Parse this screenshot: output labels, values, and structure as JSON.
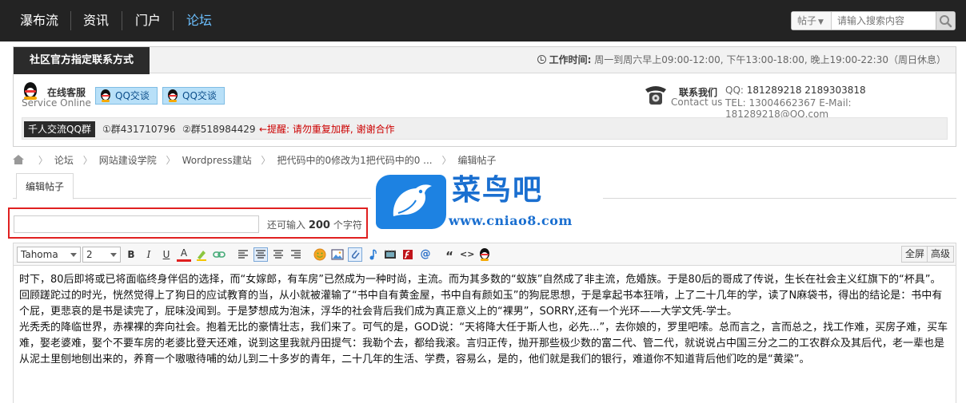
{
  "nav": {
    "items": [
      "瀑布流",
      "资讯",
      "门户",
      "论坛"
    ],
    "active_color": "#6cc0ff",
    "search": {
      "scope": "帖子",
      "placeholder": "请输入搜索内容"
    }
  },
  "contact": {
    "title": "社区官方指定联系方式",
    "work_time_label": "工作时间:",
    "work_time": "周一到周六早上09:00-12:00, 下午13:00-18:00, 晚上19:00-22:30（周日休息）",
    "online_label": "在线客服",
    "online_sub": "Service Online",
    "qq_buttons": [
      "QQ交谈",
      "QQ交谈"
    ],
    "contact_label": "联系我们",
    "contact_sub": "Contact us",
    "qq_line_label": "QQ:",
    "qq_line_value": "181289218  2189303818",
    "tel_line": "TEL: 13004662367 E-Mail: 181289218@QQ.com",
    "group_tag": "千人交流QQ群",
    "group1": "①群431710796",
    "group2": "②群518984429",
    "warning": "←提醒: 请勿重复加群, 谢谢合作"
  },
  "breadcrumb": [
    "论坛",
    "网站建设学院",
    "Wordpress建站",
    "把代码中的0修改为1把代码中的0 ...",
    "编辑帖子"
  ],
  "tab": {
    "label": "编辑帖子"
  },
  "logo": {
    "cn": "菜鸟吧",
    "url": "www.cniao8.com"
  },
  "subject": {
    "value": "",
    "count_prefix": "还可输入",
    "count": "200",
    "count_suffix": "个字符"
  },
  "toolbar": {
    "font": "Tahoma",
    "size": "2",
    "bold": "B",
    "italic": "I",
    "underline": "U",
    "color": "A",
    "quote": "“",
    "code": "<>",
    "at": "@",
    "fullscreen": "全屏",
    "advanced": "高级"
  },
  "content": {
    "paragraphs": [
      " 时下，80后即将或已将面临终身伴侣的选择，而“女嫁郎，有车房”已然成为一种时尚，主流。而为其多数的“蚁族”自然成了非主流，危婚族。于是80后的哥成了传说，生长在社会主义红旗下的“杯具”。",
      "回顾蹉跎过的时光，恍然觉得上了狗日的应试教育的当，从小就被灌输了“书中自有黄金屋，书中自有颜如玉”的狗屁思想，于是拿起书本狂啃，上了二十几年的学，读了N麻袋书，得出的结论是：书中有个屁，更悲哀的是书是读完了，屁味没闻到。于是梦想成为泡沫，浮华的社会背后我们成为真正意义上的“裸男”，SORRY,还有一个光环——大学文凭-学士。",
      "光秃秃的降临世界，赤裸裸的奔向社会。抱着无比的豪情壮志，我们来了。可气的是，GOD说：“天将降大任于斯人也，必先...”，去你娘的，罗里吧嗦。总而言之，言而总之，找工作难，买房子难，买车难，娶老婆难，娶个不要车房的老婆比登天还难，说到这里我就丹田提气：我勒个去，都给我滚。言归正传，抛开那些极少数的富二代、管二代，就说说占中国三分之二的工农群众及其后代，老一辈也是从泥土里刨地刨出来的，养育一个嗷嗷待哺的幼儿到二十多岁的青年，二十几年的生活、学费，容易么，是的，他们就是我们的银行，难道你不知道背后他们吃的是“黄梁”。"
    ]
  }
}
